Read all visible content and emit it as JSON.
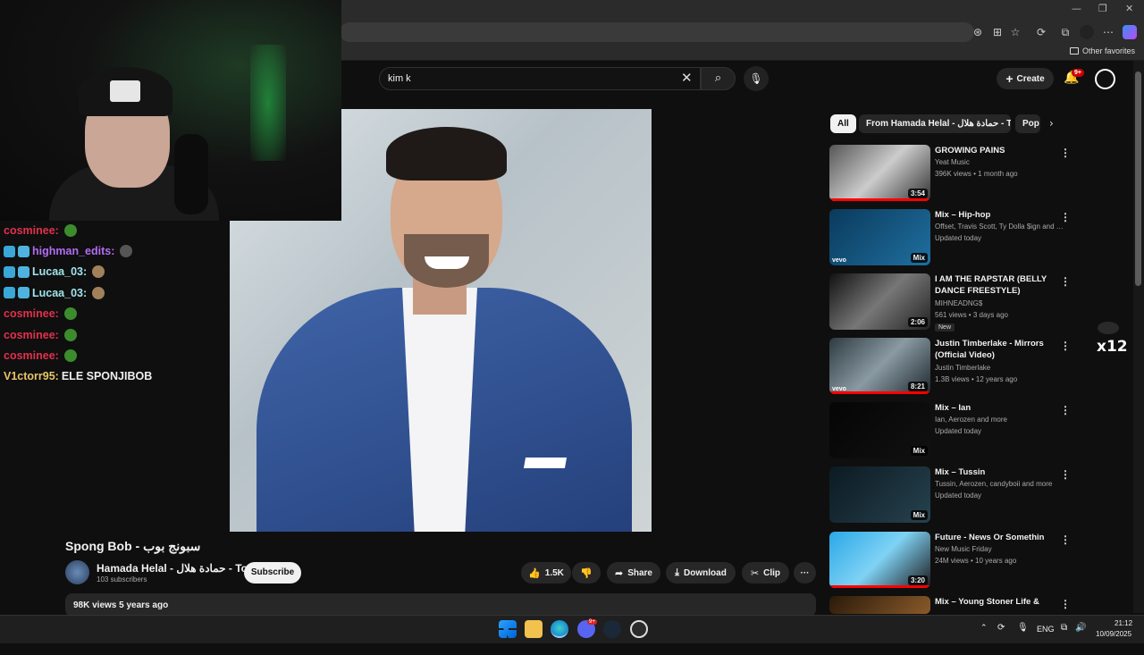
{
  "browser": {
    "favorites_label": "Other favorites",
    "window_controls": [
      "—",
      "❐",
      "✕"
    ]
  },
  "chat": {
    "messages": [
      {
        "user": "cosminee:",
        "text": "",
        "color": "#e0314b"
      },
      {
        "user": "highman_edits:",
        "text": "",
        "color": "#b26cf5"
      },
      {
        "user": "Lucaa_03:",
        "text": "",
        "color": "#a0e3ea"
      },
      {
        "user": "Lucaa_03:",
        "text": "",
        "color": "#a0e3ea"
      },
      {
        "user": "cosminee:",
        "text": "",
        "color": "#e0314b"
      },
      {
        "user": "cosminee:",
        "text": "",
        "color": "#e0314b"
      },
      {
        "user": "cosminee:",
        "text": "",
        "color": "#e0314b"
      },
      {
        "user": "V1ctorr95:",
        "text": "ELE SPONJIBOB",
        "color": "#e8c46a"
      }
    ]
  },
  "youtube": {
    "search": {
      "query": "kim k"
    },
    "create_label": "Create",
    "notifications_badge": "9+",
    "video": {
      "title": "Spong Bob - سبونج بوب",
      "channel": "Hamada Helal - حمادة هلال - Topic",
      "subscribers": "103 subscribers",
      "subscribe_label": "Subscribe",
      "likes": "1.5K",
      "share_label": "Share",
      "download_label": "Download",
      "clip_label": "Clip",
      "more_label": "···",
      "views_date": "98K views  5 years ago"
    },
    "chips": [
      "All",
      "From Hamada Helal - حمادة هلال - Topic",
      "Pop"
    ],
    "recommendations": [
      {
        "title": "GROWING PAINS",
        "channel": "Yeat Music",
        "verified": true,
        "meta": "396K views • 1 month ago",
        "duration": "3:54",
        "progress": 1.0
      },
      {
        "title": "Mix – Hip-hop",
        "channel": "Offset, Travis Scott, Ty Dolla $ign and m...",
        "verified": false,
        "meta": "Updated today",
        "duration": "Mix",
        "progress": 0
      },
      {
        "title": "I AM THE RAPSTAR (BELLY DANCE FREESTYLE)",
        "channel": "MIHNEADNG$",
        "verified": false,
        "meta": "561 views • 3 days ago",
        "duration": "2:06",
        "progress": 0,
        "badge": "New"
      },
      {
        "title": "Justin Timberlake - Mirrors (Official Video)",
        "channel": "Justin Timberlake",
        "verified": true,
        "meta": "1.3B views • 12 years ago",
        "duration": "8:21",
        "progress": 1.0
      },
      {
        "title": "Mix – Ian",
        "channel": "Ian, Aerozen and more",
        "verified": false,
        "meta": "Updated today",
        "duration": "Mix",
        "progress": 0
      },
      {
        "title": "Mix – Tussin",
        "channel": "Tussin, Aerozen, candyboii and more",
        "verified": false,
        "meta": "Updated today",
        "duration": "Mix",
        "progress": 0
      },
      {
        "title": "Future - News Or Somethin",
        "channel": "New Music Friday",
        "verified": false,
        "meta": "24M views • 10 years ago",
        "duration": "3:20",
        "progress": 1.0
      },
      {
        "title": "Mix – Young Stoner Life &",
        "channel": "",
        "verified": false,
        "meta": "",
        "duration": "",
        "progress": 0
      }
    ]
  },
  "overlay": {
    "counter": "x12"
  },
  "taskbar": {
    "language": "ENG",
    "time": "21:12",
    "date": "10/09/2025",
    "discord_badge": "9+"
  }
}
